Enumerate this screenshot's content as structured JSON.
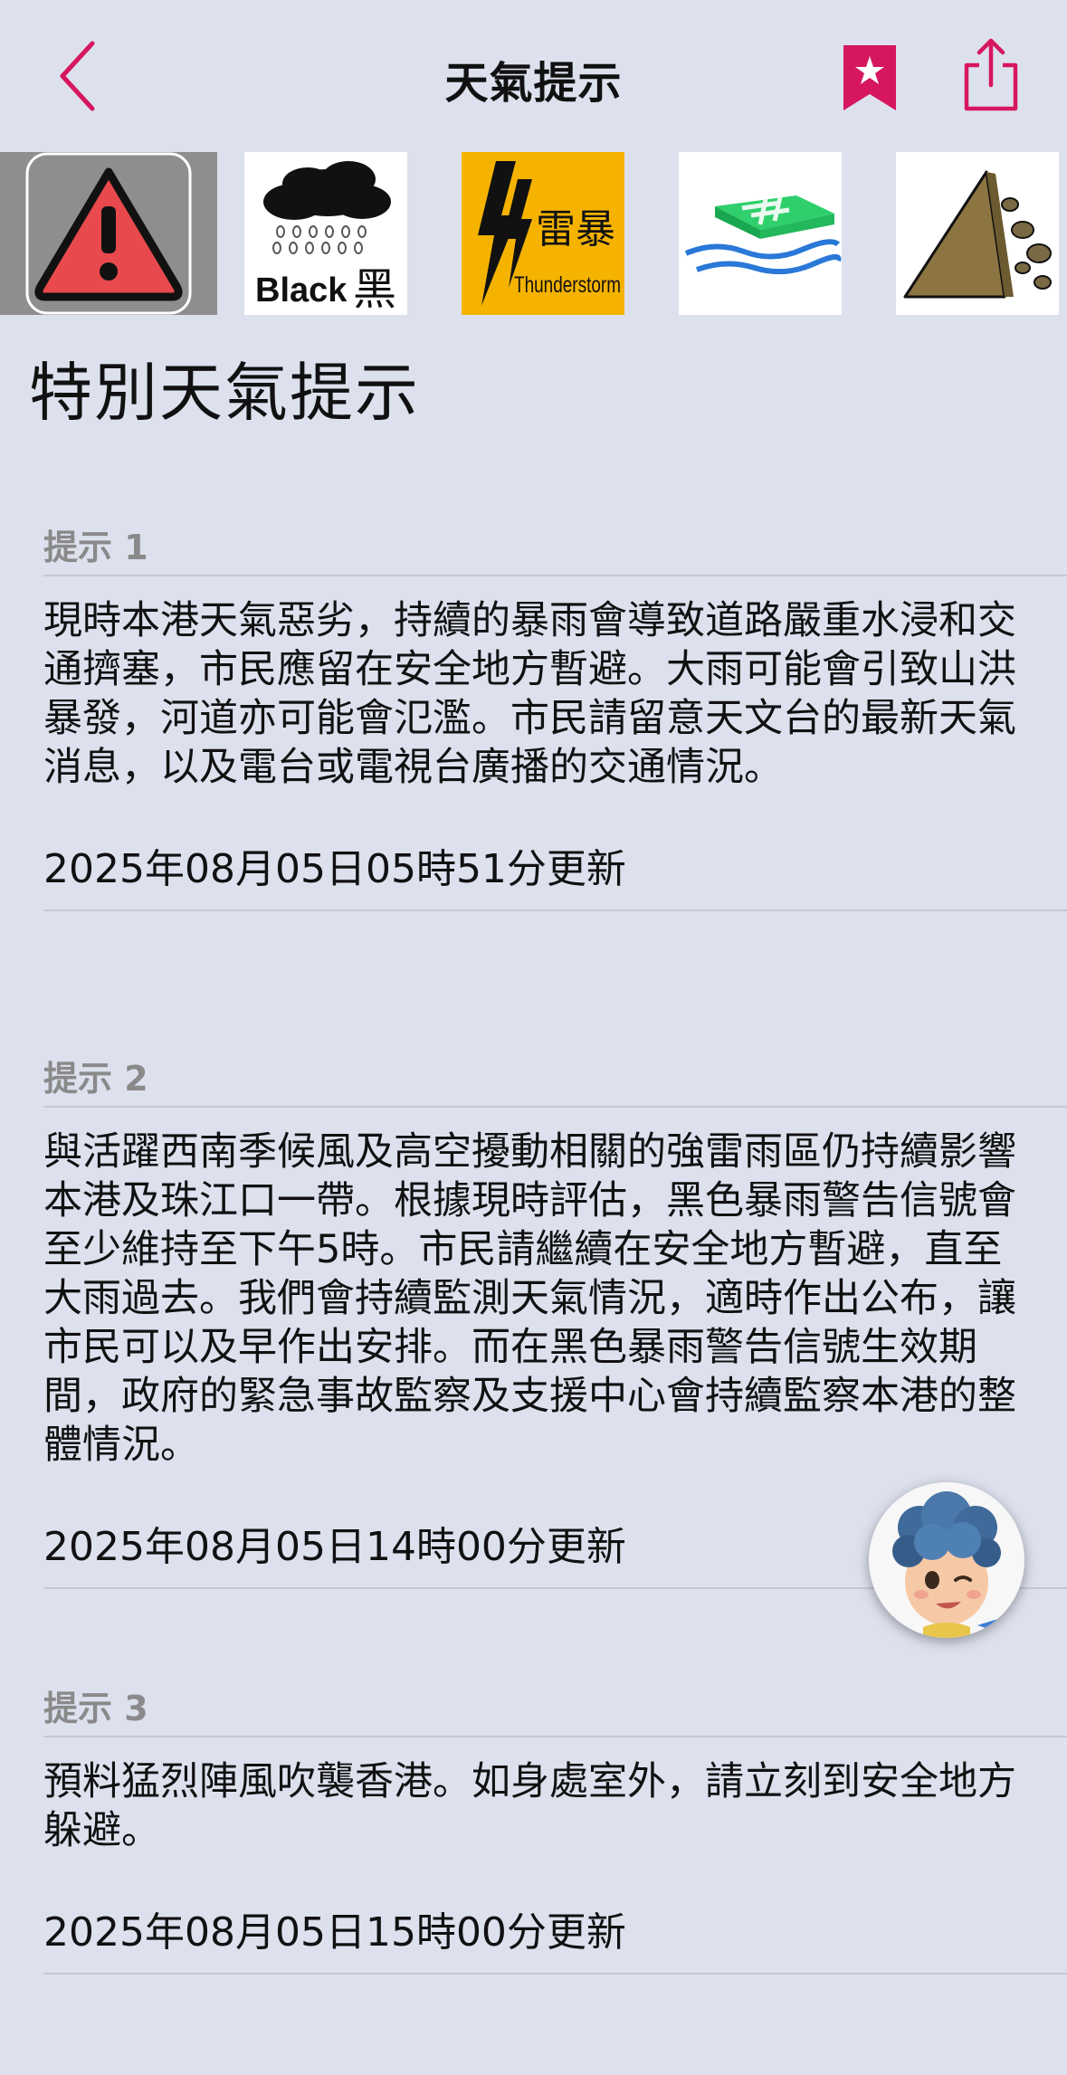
{
  "nav": {
    "title": "天氣提示",
    "back_icon": "chevron-left-icon",
    "bookmark_icon": "bookmark-star-icon",
    "share_icon": "share-icon"
  },
  "colors": {
    "accent": "#d6175f",
    "background": "#dde1ee",
    "label_grey": "#8a8a8a",
    "thunder_yellow": "#f5b300"
  },
  "warning_icons": [
    {
      "name": "special-weather-tips-icon",
      "selected": true
    },
    {
      "name": "black-rainstorm-icon",
      "text_en": "Black",
      "text_zh": "黑"
    },
    {
      "name": "thunderstorm-warning-icon",
      "text_zh": "雷暴",
      "text_en": "Thunderstorm"
    },
    {
      "name": "flooding-northern-nt-icon"
    },
    {
      "name": "landslip-icon"
    }
  ],
  "page_title": "特別天氣提示",
  "tips": [
    {
      "label": "提示 1",
      "body": "現時本港天氣惡劣，持續的暴雨會導致道路嚴重水浸和交通擠塞，市民應留在安全地方暫避。大雨可能會引致山洪暴發，河道亦可能會氾濫。市民請留意天文台的最新天氣消息，以及電台或電視台廣播的交通情況。",
      "updated": "2025年08月05日05時51分更新"
    },
    {
      "label": "提示 2",
      "body": "與活躍西南季候風及高空擾動相關的強雷雨區仍持續影響本港及珠江口一帶。根據現時評估，黑色暴雨警告信號會至少維持至下午5時。市民請繼續在安全地方暫避，直至大雨過去。我們會持續監測天氣情況，適時作出公布，讓市民可以及早作出安排。而在黑色暴雨警告信號生效期間，政府的緊急事故監察及支援中心會持續監察本港的整體情況。",
      "updated": "2025年08月05日14時00分更新"
    },
    {
      "label": "提示 3",
      "body": "預料猛烈陣風吹襲香港。如身處室外，請立刻到安全地方躲避。",
      "updated": "2025年08月05日15時00分更新"
    }
  ],
  "assistant_avatar": "assistant-avatar-icon"
}
